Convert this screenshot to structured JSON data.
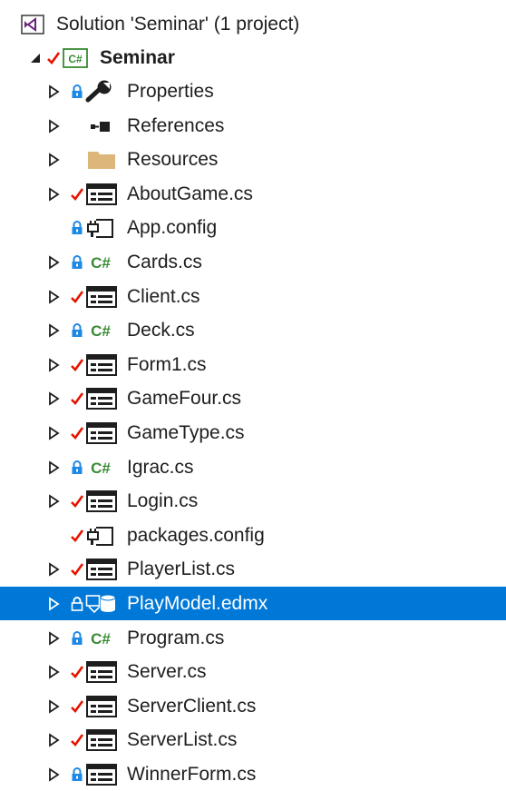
{
  "solution": {
    "label": "Solution 'Seminar' (1 project)",
    "icon": "vs-solution-icon"
  },
  "project": {
    "label": "Seminar",
    "icon": "csharp-project-icon",
    "status": "checked-out",
    "expanded": true
  },
  "items": [
    {
      "name": "properties",
      "label": "Properties",
      "icon": "wrench-icon",
      "status": "locked",
      "expandable": true
    },
    {
      "name": "references",
      "label": "References",
      "icon": "references-icon",
      "status": "none",
      "expandable": true
    },
    {
      "name": "resources",
      "label": "Resources",
      "icon": "folder-icon",
      "status": "none",
      "expandable": true
    },
    {
      "name": "aboutgame-cs",
      "label": "AboutGame.cs",
      "icon": "form-icon",
      "status": "checked-out",
      "expandable": true
    },
    {
      "name": "app-config",
      "label": "App.config",
      "icon": "config-icon",
      "status": "locked",
      "expandable": false
    },
    {
      "name": "cards-cs",
      "label": "Cards.cs",
      "icon": "csharp-file-icon",
      "status": "locked",
      "expandable": true
    },
    {
      "name": "client-cs",
      "label": "Client.cs",
      "icon": "form-icon",
      "status": "checked-out",
      "expandable": true
    },
    {
      "name": "deck-cs",
      "label": "Deck.cs",
      "icon": "csharp-file-icon",
      "status": "locked",
      "expandable": true
    },
    {
      "name": "form1-cs",
      "label": "Form1.cs",
      "icon": "form-icon",
      "status": "checked-out",
      "expandable": true
    },
    {
      "name": "gamefour-cs",
      "label": "GameFour.cs",
      "icon": "form-icon",
      "status": "checked-out",
      "expandable": true
    },
    {
      "name": "gametype-cs",
      "label": "GameType.cs",
      "icon": "form-icon",
      "status": "checked-out",
      "expandable": true
    },
    {
      "name": "igrac-cs",
      "label": "Igrac.cs",
      "icon": "csharp-file-icon",
      "status": "locked",
      "expandable": true
    },
    {
      "name": "login-cs",
      "label": "Login.cs",
      "icon": "form-icon",
      "status": "checked-out",
      "expandable": true
    },
    {
      "name": "packages-config",
      "label": "packages.config",
      "icon": "config-icon",
      "status": "checked-out",
      "expandable": false
    },
    {
      "name": "playerlist-cs",
      "label": "PlayerList.cs",
      "icon": "form-icon",
      "status": "checked-out",
      "expandable": true
    },
    {
      "name": "playmodel-edmx",
      "label": "PlayModel.edmx",
      "icon": "edmx-icon",
      "status": "locked",
      "expandable": true,
      "selected": true
    },
    {
      "name": "program-cs",
      "label": "Program.cs",
      "icon": "csharp-file-icon",
      "status": "locked",
      "expandable": true
    },
    {
      "name": "server-cs",
      "label": "Server.cs",
      "icon": "form-icon",
      "status": "checked-out",
      "expandable": true
    },
    {
      "name": "serverclient-cs",
      "label": "ServerClient.cs",
      "icon": "form-icon",
      "status": "checked-out",
      "expandable": true
    },
    {
      "name": "serverlist-cs",
      "label": "ServerList.cs",
      "icon": "form-icon",
      "status": "checked-out",
      "expandable": true
    },
    {
      "name": "winnerform-cs",
      "label": "WinnerForm.cs",
      "icon": "form-icon",
      "status": "locked",
      "expandable": true
    }
  ],
  "colors": {
    "selection": "#0078d7",
    "checkmark": "#e51400",
    "lock": "#1e88e5",
    "csharp": "#388a34",
    "folder": "#dcb67a",
    "vs_purple": "#68217a"
  }
}
